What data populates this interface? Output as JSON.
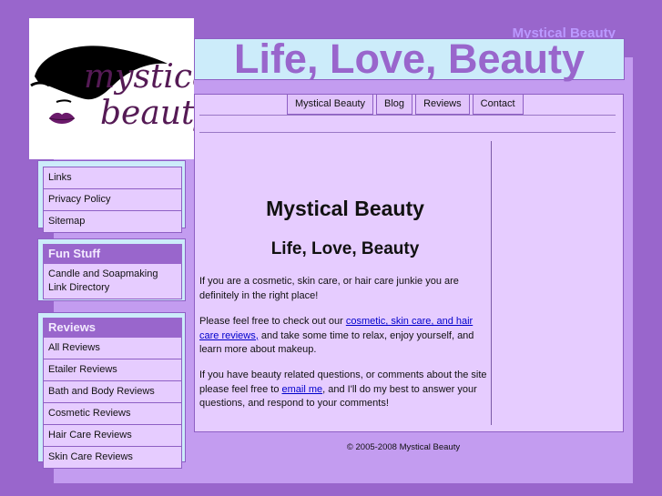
{
  "header": {
    "site_name": "Mystical Beauty",
    "title": "Life, Love, Beauty"
  },
  "logo": {
    "line1": "mystical",
    "line2": "beauty"
  },
  "nav": {
    "items": [
      "Mystical Beauty",
      "Blog",
      "Reviews",
      "Contact"
    ]
  },
  "sidebar": {
    "links_box": {
      "items": [
        "Links",
        "Privacy Policy",
        "Sitemap"
      ]
    },
    "fun_stuff": {
      "heading": "Fun Stuff",
      "items": [
        "Candle and Soapmaking Link Directory"
      ]
    },
    "reviews": {
      "heading": "Reviews",
      "items": [
        "All Reviews",
        "Etailer Reviews",
        "Bath and Body Reviews",
        "Cosmetic Reviews",
        "Hair Care Reviews",
        "Skin Care Reviews"
      ]
    }
  },
  "main": {
    "heading": "Mystical Beauty",
    "subheading": "Life, Love, Beauty",
    "para1": "If you are a cosmetic, skin care, or hair care junkie you are definitely in the right place!",
    "para2_before": "Please feel free to check out our ",
    "para2_link": "cosmetic, skin care, and hair care reviews,",
    "para2_after": " and take some time to relax, enjoy yourself, and learn more about makeup.",
    "para3_before": "If you have beauty related questions, or comments about the site please feel free to ",
    "para3_link": "email me",
    "para3_after": ", and I'll do my best to answer your questions, and respond to your comments!"
  },
  "footer": {
    "copyright": "© 2005-2008 Mystical Beauty"
  },
  "colors": {
    "background": "#9966cc",
    "panel": "#c39cf0",
    "content": "#e6ccff",
    "header_bar": "#ccecfa",
    "title_text": "#9966cc",
    "link": "#0000cc",
    "logo_text": "#551a55"
  }
}
